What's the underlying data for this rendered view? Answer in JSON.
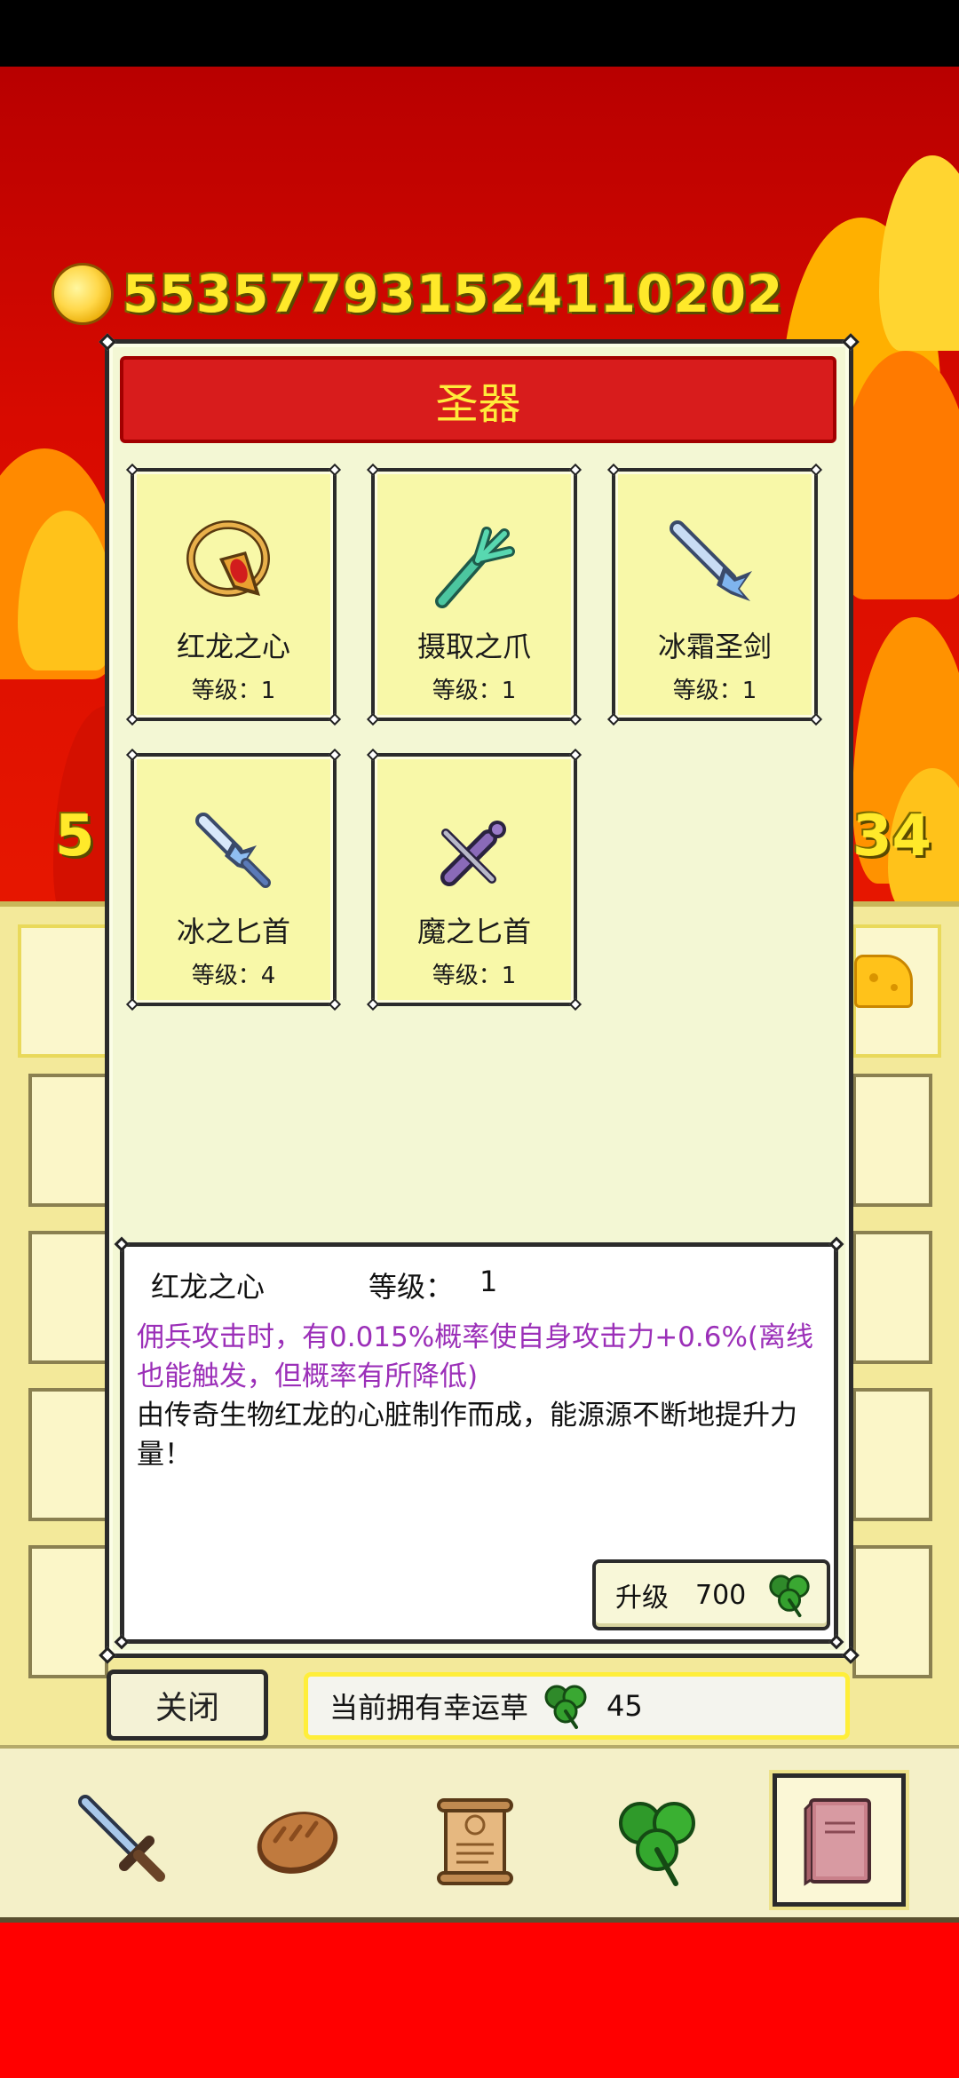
{
  "status_bar": {},
  "header": {
    "coins": "55357793152411020​2",
    "coins_clean": "553577931524110202",
    "left_partial_number": "5",
    "right_partial_number": "34"
  },
  "dialog": {
    "title": "圣器",
    "relics": [
      {
        "name": "红龙之心",
        "level": "等级：1",
        "icon": "red-dragon-heart-amulet-icon"
      },
      {
        "name": "摄取之爪",
        "level": "等级：1",
        "icon": "claw-icon"
      },
      {
        "name": "冰霜圣剑",
        "level": "等级：1",
        "icon": "frost-sword-icon"
      },
      {
        "name": "冰之匕首",
        "level": "等级：4",
        "icon": "ice-dagger-icon"
      },
      {
        "name": "魔之匕首",
        "level": "等级：1",
        "icon": "magic-dagger-icon"
      }
    ],
    "detail": {
      "name": "红龙之心",
      "level_label": "等级：",
      "level_value": "1",
      "effect": "佣兵攻击时，有0.015%概率使自身攻击力+0.6%(离线也能触发，但概率有所降低)",
      "description": "由传奇生物红龙的心脏制作而成，能源源不断地提升力量！",
      "upgrade_label": "升级",
      "upgrade_cost": "700"
    },
    "close_label": "关闭",
    "clover_label": "当前拥有幸运草",
    "clover_count": "45"
  },
  "bottom_nav": {
    "items": [
      "sword-icon",
      "bread-icon",
      "scroll-icon",
      "clover-icon",
      "book-icon"
    ],
    "active": "book-icon"
  },
  "colors": {
    "title_bg": "#d81c1c",
    "title_text": "#ffeb3b",
    "card_bg": "#f8f8a8",
    "effect_text": "#9b2fb8",
    "coin_text": "#ffe92a"
  }
}
